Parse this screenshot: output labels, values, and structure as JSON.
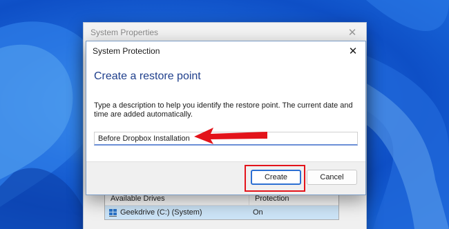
{
  "background_window": {
    "title": "System Properties",
    "close_glyph": "✕",
    "drives_table": {
      "headers": [
        "Available Drives",
        "Protection"
      ],
      "rows": [
        {
          "drive": "Geekdrive (C:) (System)",
          "protection": "On",
          "icon": "drive-icon"
        }
      ]
    }
  },
  "dialog": {
    "title": "System Protection",
    "close_glyph": "✕",
    "heading": "Create a restore point",
    "description": "Type a description to help you identify the restore point. The current date and time are added automatically.",
    "input_value": "Before Dropbox Installation",
    "buttons": {
      "create": "Create",
      "cancel": "Cancel"
    }
  },
  "annotations": {
    "arrow_color": "#e3131a",
    "highlight_color": "#e3131a"
  }
}
